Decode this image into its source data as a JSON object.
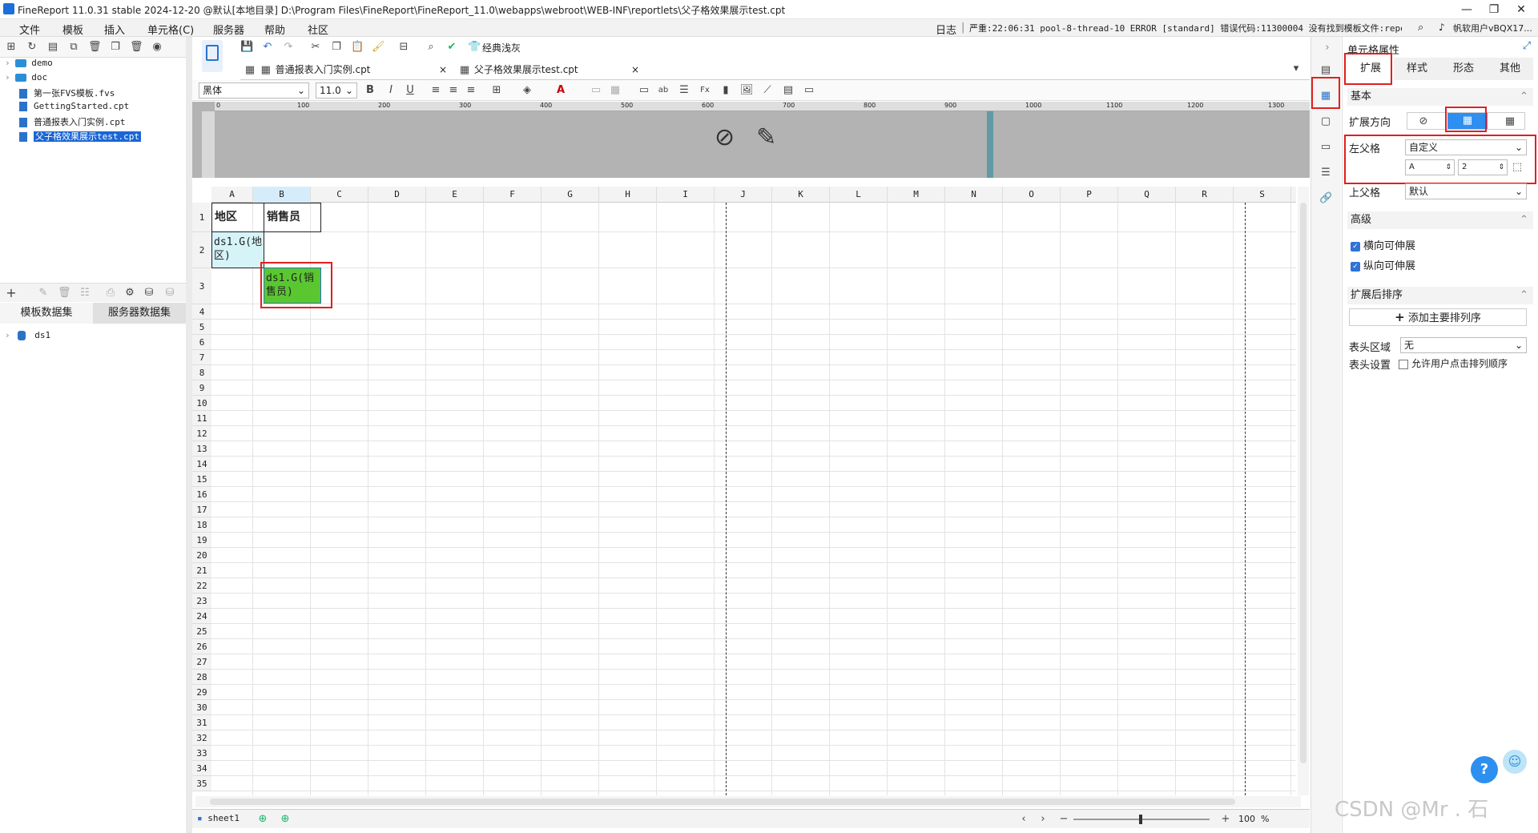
{
  "title": "FineReport 11.0.31 stable 2024-12-20 @默认[本地目录]   D:\\Program Files\\FineReport\\FineReport_11.0\\webapps\\webroot\\WEB-INF\\reportlets\\父子格效果展示test.cpt",
  "window_controls": {
    "minimize": "—",
    "maximize": "❐",
    "close": "✕"
  },
  "menu": [
    "文件",
    "模板",
    "插入",
    "单元格(C)",
    "服务器",
    "帮助",
    "社区"
  ],
  "log": {
    "label": "日志",
    "separator": "|",
    "text": "严重:22:06:31 pool-8-thread-10 ERROR [standard] 错误代码:11300004 没有找到模板文件:reportl...",
    "user": "帆软用户vBQX17..."
  },
  "tree": [
    {
      "type": "folder",
      "name": "demo"
    },
    {
      "type": "folder",
      "name": "doc"
    },
    {
      "type": "file",
      "name": "第一张FVS模板.fvs"
    },
    {
      "type": "file",
      "name": "GettingStarted.cpt"
    },
    {
      "type": "file",
      "name": "普通报表入门实例.cpt"
    },
    {
      "type": "file",
      "name": "父子格效果展示test.cpt",
      "selected": true
    }
  ],
  "dataset_tabs": [
    "模板数据集",
    "服务器数据集"
  ],
  "datasets": [
    "ds1"
  ],
  "toolbar": {
    "classic_label": "经典浅灰"
  },
  "doc_tabs": [
    "普通报表入门实例.cpt",
    "父子格效果展示test.cpt"
  ],
  "font": {
    "name": "黑体",
    "size": "11.0"
  },
  "ruler_ticks": [
    "0",
    "100",
    "200",
    "300",
    "400",
    "500",
    "600",
    "700",
    "800",
    "900",
    "1000",
    "1100",
    "1200",
    "1300"
  ],
  "columns": [
    "A",
    "B",
    "C",
    "D",
    "E",
    "F",
    "G",
    "H",
    "I",
    "J",
    "K",
    "L",
    "M",
    "N",
    "O",
    "P",
    "Q",
    "R",
    "S"
  ],
  "rows": [
    "1",
    "2",
    "3",
    "4",
    "5",
    "6",
    "7",
    "8",
    "9",
    "10",
    "11",
    "12",
    "13",
    "14",
    "15",
    "16",
    "17",
    "18",
    "19",
    "20",
    "21",
    "22",
    "23",
    "24",
    "25",
    "26",
    "27",
    "28",
    "29",
    "30",
    "31",
    "32",
    "33",
    "34",
    "35"
  ],
  "cells": {
    "a1": "地区",
    "b1": "销售员",
    "a2": "ds1.G(地区)",
    "b3": "ds1.G(销售员)"
  },
  "sheet": {
    "name": "sheet1",
    "zoom": "100",
    "zoom_unit": "%"
  },
  "right_panel": {
    "title": "单元格属性",
    "tabs": [
      "扩展",
      "样式",
      "形态",
      "其他"
    ],
    "basic_section": "基本",
    "expand_dir_label": "扩展方向",
    "left_parent_label": "左父格",
    "left_parent_value": "自定义",
    "left_parent_col": "A",
    "left_parent_row": "2",
    "top_parent_label": "上父格",
    "top_parent_value": "默认",
    "advanced_section": "高级",
    "h_extendable": "横向可伸展",
    "v_extendable": "纵向可伸展",
    "sort_section": "扩展后排序",
    "add_sort": "添加主要排列序",
    "header_area_label": "表头区域",
    "header_area_value": "无",
    "header_settings_label": "表头设置",
    "allow_user_sort": "允许用户点击排列顺序"
  },
  "watermark": "CSDN @Mr . 石"
}
